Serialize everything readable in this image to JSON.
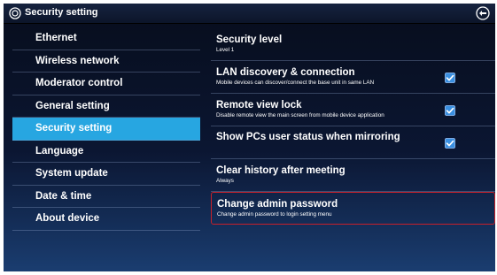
{
  "titlebar": {
    "title": "Security setting",
    "logo_icon": "brand-logo-icon",
    "back_icon": "back-icon"
  },
  "sidebar": {
    "items": [
      {
        "label": "Ethernet",
        "active": false
      },
      {
        "label": "Wireless network",
        "active": false
      },
      {
        "label": "Moderator control",
        "active": false
      },
      {
        "label": "General setting",
        "active": false
      },
      {
        "label": "Security setting",
        "active": true
      },
      {
        "label": "Language",
        "active": false
      },
      {
        "label": "System update",
        "active": false
      },
      {
        "label": "Date & time",
        "active": false
      },
      {
        "label": "About device",
        "active": false
      }
    ]
  },
  "settings": [
    {
      "title": "Security level",
      "subtitle": "Level 1"
    },
    {
      "title": "LAN discovery & connection",
      "subtitle": "Mobile devices can discover/connect the base unit in same LAN",
      "checked": true
    },
    {
      "title": "Remote view lock",
      "subtitle": "Disable remote view the main screen from mobile device application",
      "checked": true
    },
    {
      "title": "Show PCs user status when mirroring",
      "checked": true
    },
    {
      "title": "Clear history after meeting",
      "subtitle": "Always"
    },
    {
      "title": "Change admin password",
      "subtitle": "Change admin password to login setting menu",
      "highlighted": true
    }
  ],
  "colors": {
    "active_item": "#27a6e1",
    "highlight_border": "#c8202a",
    "checkbox": "#3a8fe0"
  }
}
